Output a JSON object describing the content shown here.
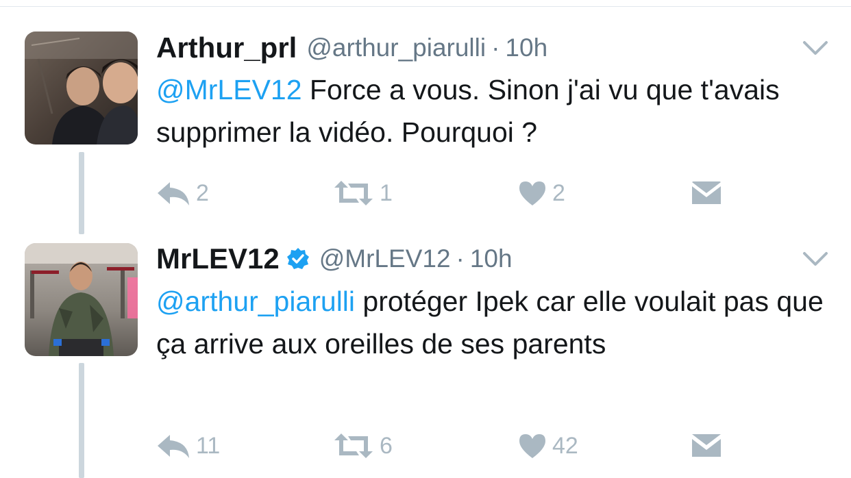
{
  "tweets": [
    {
      "display_name": "Arthur_prl",
      "handle": "@arthur_piarulli",
      "separator": "·",
      "time": "10h",
      "mention": "@MrLEV12",
      "text": " Force a vous. Sinon j'ai vu que t'avais supprimer la vidéo. Pourquoi ?",
      "reply_count": "2",
      "retweet_count": "1",
      "like_count": "2",
      "verified": false
    },
    {
      "display_name": "MrLEV12",
      "handle": "@MrLEV12",
      "separator": "·",
      "time": "10h",
      "mention": "@arthur_piarulli",
      "text": " protéger Ipek car elle voulait pas que ça arrive aux oreilles de ses parents",
      "reply_count": "11",
      "retweet_count": "6",
      "like_count": "42",
      "verified": true
    }
  ],
  "colors": {
    "link": "#1da1f2",
    "text": "#14171a",
    "secondary": "#657786",
    "action_icon": "#aab8c2",
    "thread_line": "#ccd6dd",
    "verified": "#1da1f2"
  },
  "icons": {
    "reply": "reply-icon",
    "retweet": "retweet-icon",
    "like": "heart-icon",
    "message": "envelope-icon",
    "more": "chevron-down-icon",
    "verified": "verified-badge-icon"
  }
}
